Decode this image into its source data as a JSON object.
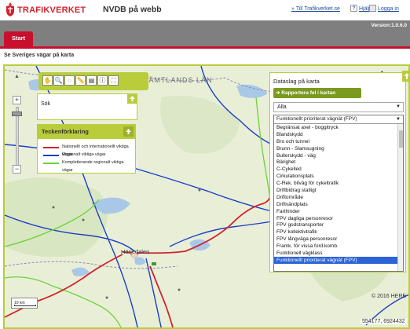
{
  "header": {
    "brand": "TRAFIKVERKET",
    "app_title": "NVDB på webb",
    "link_trafikverket": "» Till Trafikverket.se",
    "help": "Hjälp",
    "help_icon": "?",
    "login": "Logga in"
  },
  "topbar": {
    "version": "Version:1.0.6.0",
    "tab_start": "Start"
  },
  "page": {
    "subtitle": "Se Sveriges vägar på karta"
  },
  "map": {
    "region_label": "JÄMTLANDS LÄN",
    "town_label": "Härjedalen",
    "copyright": "© 2016 HERE",
    "coordinates": "554177, 6924432",
    "scale_label": "10 km",
    "zoom_in": "+",
    "zoom_out": "−",
    "pan_north": "▲"
  },
  "toolbar": {
    "tools": [
      {
        "icon": "pan-hand-icon",
        "glyph": "✋"
      },
      {
        "icon": "zoom-box-icon",
        "glyph": "🔍"
      },
      {
        "icon": "lasso-icon",
        "glyph": "◌"
      },
      {
        "icon": "measure-icon",
        "glyph": "📏"
      },
      {
        "icon": "layers-icon",
        "glyph": "▤"
      },
      {
        "icon": "info-icon",
        "glyph": "ⓘ"
      },
      {
        "icon": "fullscreen-icon",
        "glyph": "⛶"
      }
    ]
  },
  "search": {
    "label": "Sök"
  },
  "legend": {
    "title": "Teckenförklaring",
    "items": [
      {
        "label": "Nationellt och internationellt viktiga vägar",
        "color": "#d0232d"
      },
      {
        "label": "Regionalt viktiga vägar",
        "color": "#1a3ec8"
      },
      {
        "label": "Kompletterande regionalt viktiga vägar",
        "color": "#6ad33a"
      }
    ]
  },
  "dataslag": {
    "title": "Dataslag på karta",
    "report_button": "Rapportera fel i kartan",
    "filter_value": "Alla",
    "list_selected": "Funktionellt prioriterat vägnät (FPV)",
    "options": [
      "Begränsat axel - boggitryck",
      "Blandskydd",
      "Bro och tunnel",
      "Brunn - Slamsugning",
      "Bullerskydd - väg",
      "Bärighet",
      "C-Cykelled",
      "Cirkulationsplats",
      "C-Rek. bilväg för cykeltrafik",
      "Driftbidrag statligt",
      "Driftområde",
      "Driftvändplats",
      "Farthinder",
      "FPV dagliga personresor",
      "FPV godstransporter",
      "FPV kollektivtrafik",
      "FPV långväga personresor",
      "Framk. för vissa ford.komb.",
      "Funktionell vägklass",
      "Funktionellt prioriterat vägnät (FPV)"
    ]
  },
  "colors": {
    "accent_red": "#c8102e",
    "panel_green": "#b9cc3a",
    "topbar_gray": "#7f7f7f"
  }
}
